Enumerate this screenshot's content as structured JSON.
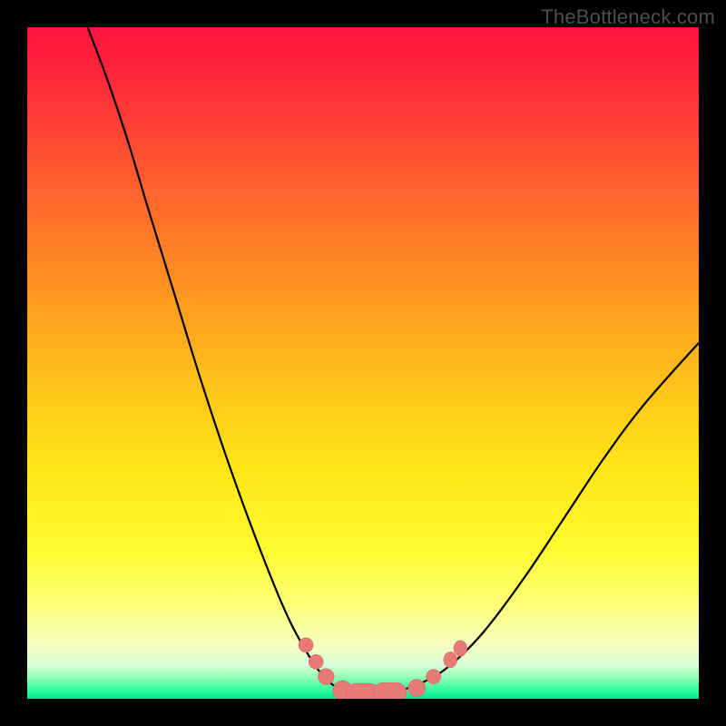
{
  "attribution": "TheBottleneck.com",
  "colors": {
    "frame": "#000000",
    "curve_stroke": "#000000",
    "marker_fill": "#e77a77",
    "marker_stroke": "#d66462"
  },
  "chart_data": {
    "type": "line",
    "title": "",
    "xlabel": "",
    "ylabel": "",
    "xlim": [
      0,
      100
    ],
    "ylim": [
      0,
      100
    ],
    "grid": false,
    "left_curve": [
      {
        "x": 9,
        "y": 100
      },
      {
        "x": 12,
        "y": 92
      },
      {
        "x": 15,
        "y": 83
      },
      {
        "x": 18,
        "y": 73
      },
      {
        "x": 22,
        "y": 60
      },
      {
        "x": 26,
        "y": 47
      },
      {
        "x": 30,
        "y": 35
      },
      {
        "x": 34,
        "y": 24
      },
      {
        "x": 38,
        "y": 14
      },
      {
        "x": 41,
        "y": 8
      },
      {
        "x": 44,
        "y": 3.5
      },
      {
        "x": 47,
        "y": 1.2
      },
      {
        "x": 50,
        "y": 0.8
      }
    ],
    "right_curve": [
      {
        "x": 50,
        "y": 0.8
      },
      {
        "x": 55,
        "y": 1.2
      },
      {
        "x": 59,
        "y": 2.5
      },
      {
        "x": 63,
        "y": 5
      },
      {
        "x": 68,
        "y": 10
      },
      {
        "x": 74,
        "y": 18
      },
      {
        "x": 80,
        "y": 27
      },
      {
        "x": 86,
        "y": 36
      },
      {
        "x": 92,
        "y": 44
      },
      {
        "x": 100,
        "y": 53
      }
    ],
    "markers": [
      {
        "x": 41.5,
        "y": 8,
        "r": 1.1
      },
      {
        "x": 43,
        "y": 5.5,
        "r": 1.1
      },
      {
        "x": 44.5,
        "y": 3.3,
        "r": 1.2
      },
      {
        "x": 47,
        "y": 1.2,
        "r": 1.5,
        "w": 3
      },
      {
        "x": 50,
        "y": 0.8,
        "r": 1.5,
        "w": 5
      },
      {
        "x": 54,
        "y": 0.9,
        "r": 1.5,
        "w": 5
      },
      {
        "x": 58,
        "y": 1.6,
        "r": 1.3
      },
      {
        "x": 60.5,
        "y": 3.3,
        "r": 1.1
      },
      {
        "x": 63,
        "y": 5.8,
        "r": 1.2,
        "w": 2
      },
      {
        "x": 64.5,
        "y": 7.5,
        "r": 1.2,
        "w": 2
      }
    ]
  }
}
